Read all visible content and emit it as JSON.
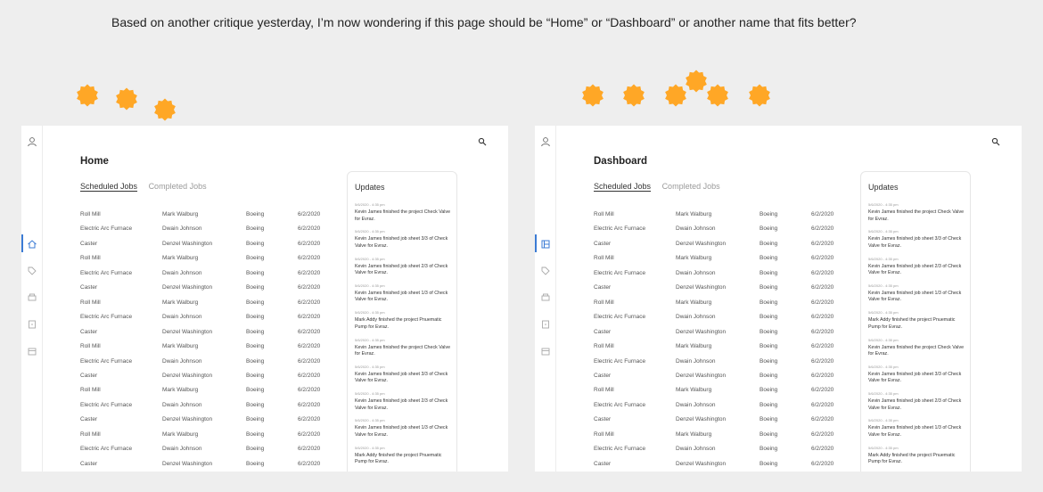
{
  "caption": "Based on another critique yesterday, I’m now wondering if this page should be “Home” or “Dashboard” or another name that fits better?",
  "reaction_icon": "orange-flower-reaction-icon",
  "colors": {
    "reaction": "#ffa726",
    "accent": "#3b7bd4",
    "background": "#eeeeee"
  },
  "left": {
    "title": "Home",
    "tabs": [
      "Scheduled Jobs",
      "Completed Jobs"
    ],
    "updates_title": "Updates",
    "rows": [
      [
        "Roll Mill",
        "Mark Walburg",
        "Boeing",
        "6/2/2020"
      ],
      [
        "Electric Arc Furnace",
        "Dwain Johnson",
        "Boeing",
        "6/2/2020"
      ],
      [
        "Caster",
        "Denzel Washington",
        "Boeing",
        "6/2/2020"
      ],
      [
        "Roll Mill",
        "Mark Walburg",
        "Boeing",
        "6/2/2020"
      ],
      [
        "Electric Arc Furnace",
        "Dwain Johnson",
        "Boeing",
        "6/2/2020"
      ],
      [
        "Caster",
        "Denzel Washington",
        "Boeing",
        "6/2/2020"
      ],
      [
        "Roll Mill",
        "Mark Walburg",
        "Boeing",
        "6/2/2020"
      ],
      [
        "Electric Arc Furnace",
        "Dwain Johnson",
        "Boeing",
        "6/2/2020"
      ],
      [
        "Caster",
        "Denzel Washington",
        "Boeing",
        "6/2/2020"
      ],
      [
        "Roll Mill",
        "Mark Walburg",
        "Boeing",
        "6/2/2020"
      ],
      [
        "Electric Arc Furnace",
        "Dwain Johnson",
        "Boeing",
        "6/2/2020"
      ],
      [
        "Caster",
        "Denzel Washington",
        "Boeing",
        "6/2/2020"
      ],
      [
        "Roll Mill",
        "Mark Walburg",
        "Boeing",
        "6/2/2020"
      ],
      [
        "Electric Arc Furnace",
        "Dwain Johnson",
        "Boeing",
        "6/2/2020"
      ],
      [
        "Caster",
        "Denzel Washington",
        "Boeing",
        "6/2/2020"
      ],
      [
        "Roll Mill",
        "Mark Walburg",
        "Boeing",
        "6/2/2020"
      ],
      [
        "Electric Arc Furnace",
        "Dwain Johnson",
        "Boeing",
        "6/2/2020"
      ],
      [
        "Caster",
        "Denzel Washington",
        "Boeing",
        "6/2/2020"
      ]
    ],
    "updates": [
      {
        "time": "5/6/2020 - 4:35 pm",
        "text": "Kevin James finished the project Check Valve for Evraz."
      },
      {
        "time": "5/6/2020 - 4:35 pm",
        "text": "Kevin James finished job sheet 3/3 of Check Valve for Evraz."
      },
      {
        "time": "5/6/2020 - 4:35 pm",
        "text": "Kevin James finished job sheet 2/3 of Check Valve for Evraz."
      },
      {
        "time": "5/6/2020 - 4:35 pm",
        "text": "Kevin James finished job sheet 1/3 of Check Valve for Evraz."
      },
      {
        "time": "5/6/2020 - 4:35 pm",
        "text": "Mark Addy finished the project Pnuematic Pump for Evraz."
      },
      {
        "time": "5/6/2020 - 4:35 pm",
        "text": "Kevin James finished the project Check Valve for Evraz."
      },
      {
        "time": "5/6/2020 - 4:35 pm",
        "text": "Kevin James finished job sheet 3/3 of Check Valve for Evraz."
      },
      {
        "time": "5/6/2020 - 4:35 pm",
        "text": "Kevin James finished job sheet 2/3 of Check Valve for Evraz."
      },
      {
        "time": "5/6/2020 - 4:35 pm",
        "text": "Kevin James finished job sheet 1/3 of Check Valve for Evraz."
      },
      {
        "time": "5/6/2020 - 4:35 pm",
        "text": "Mark Addy finished the project Pnuematic Pump for Evraz."
      }
    ]
  },
  "right": {
    "title": "Dashboard",
    "tabs": [
      "Scheduled Jobs",
      "Completed Jobs"
    ],
    "updates_title": "Updates",
    "rows": [
      [
        "Roll Mill",
        "Mark Walburg",
        "Boeing",
        "6/2/2020"
      ],
      [
        "Electric Arc Furnace",
        "Dwain Johnson",
        "Boeing",
        "6/2/2020"
      ],
      [
        "Caster",
        "Denzel Washington",
        "Boeing",
        "6/2/2020"
      ],
      [
        "Roll Mill",
        "Mark Walburg",
        "Boeing",
        "6/2/2020"
      ],
      [
        "Electric Arc Furnace",
        "Dwain Johnson",
        "Boeing",
        "6/2/2020"
      ],
      [
        "Caster",
        "Denzel Washington",
        "Boeing",
        "6/2/2020"
      ],
      [
        "Roll Mill",
        "Mark Walburg",
        "Boeing",
        "6/2/2020"
      ],
      [
        "Electric Arc Furnace",
        "Dwain Johnson",
        "Boeing",
        "6/2/2020"
      ],
      [
        "Caster",
        "Denzel Washington",
        "Boeing",
        "6/2/2020"
      ],
      [
        "Roll Mill",
        "Mark Walburg",
        "Boeing",
        "6/2/2020"
      ],
      [
        "Electric Arc Furnace",
        "Dwain Johnson",
        "Boeing",
        "6/2/2020"
      ],
      [
        "Caster",
        "Denzel Washington",
        "Boeing",
        "6/2/2020"
      ],
      [
        "Roll Mill",
        "Mark Walburg",
        "Boeing",
        "6/2/2020"
      ],
      [
        "Electric Arc Furnace",
        "Dwain Johnson",
        "Boeing",
        "6/2/2020"
      ],
      [
        "Caster",
        "Denzel Washington",
        "Boeing",
        "6/2/2020"
      ],
      [
        "Roll Mill",
        "Mark Walburg",
        "Boeing",
        "6/2/2020"
      ],
      [
        "Electric Arc Furnace",
        "Dwain Johnson",
        "Boeing",
        "6/2/2020"
      ],
      [
        "Caster",
        "Denzel Washington",
        "Boeing",
        "6/2/2020"
      ]
    ],
    "updates": [
      {
        "time": "5/6/2020 - 4:35 pm",
        "text": "Kevin James finished the project Check Valve for Evraz."
      },
      {
        "time": "5/6/2020 - 4:35 pm",
        "text": "Kevin James finished job sheet 3/3 of Check Valve for Evraz."
      },
      {
        "time": "5/6/2020 - 4:35 pm",
        "text": "Kevin James finished job sheet 2/3 of Check Valve for Evraz."
      },
      {
        "time": "5/6/2020 - 4:35 pm",
        "text": "Kevin James finished job sheet 1/3 of Check Valve for Evraz."
      },
      {
        "time": "5/6/2020 - 4:35 pm",
        "text": "Mark Addy finished the project Pnuematic Pump for Evraz."
      },
      {
        "time": "5/6/2020 - 4:35 pm",
        "text": "Kevin James finished the project Check Valve for Evraz."
      },
      {
        "time": "5/6/2020 - 4:35 pm",
        "text": "Kevin James finished job sheet 3/3 of Check Valve for Evraz."
      },
      {
        "time": "5/6/2020 - 4:35 pm",
        "text": "Kevin James finished job sheet 2/3 of Check Valve for Evraz."
      },
      {
        "time": "5/6/2020 - 4:35 pm",
        "text": "Kevin James finished job sheet 1/3 of Check Valve for Evraz."
      },
      {
        "time": "5/6/2020 - 4:35 pm",
        "text": "Mark Addy finished the project Pnuematic Pump for Evraz."
      }
    ]
  }
}
